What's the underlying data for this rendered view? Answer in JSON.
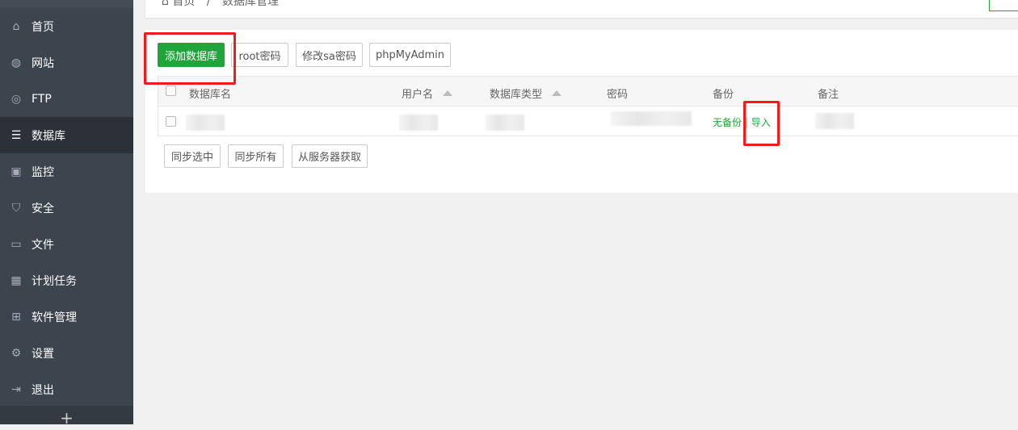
{
  "sidebar": {
    "items": [
      {
        "label": "首页",
        "icon": "home-icon"
      },
      {
        "label": "网站",
        "icon": "globe-icon"
      },
      {
        "label": "FTP",
        "icon": "ftp-icon"
      },
      {
        "label": "数据库",
        "icon": "database-icon"
      },
      {
        "label": "监控",
        "icon": "monitor-icon"
      },
      {
        "label": "安全",
        "icon": "shield-icon"
      },
      {
        "label": "文件",
        "icon": "folder-icon"
      },
      {
        "label": "计划任务",
        "icon": "calendar-icon"
      },
      {
        "label": "软件管理",
        "icon": "apps-icon"
      },
      {
        "label": "设置",
        "icon": "gear-icon"
      },
      {
        "label": "退出",
        "icon": "logout-icon"
      }
    ],
    "active": "数据库",
    "add": "+"
  },
  "breadcrumb": {
    "home": "首页",
    "sep": "/",
    "current": "数据库管理"
  },
  "toolbar": {
    "add_db": "添加数据库",
    "root_pwd": "root密码",
    "sa_pwd": "修改sa密码",
    "phpmyadmin": "phpMyAdmin"
  },
  "table": {
    "headers": [
      "数据库名",
      "用户名",
      "数据库类型",
      "密码",
      "备份",
      "备注"
    ],
    "row": {
      "backup_status": "无备份",
      "sep": "|",
      "import": "导入"
    }
  },
  "bottom": {
    "sync_selected": "同步选中",
    "sync_all": "同步所有",
    "fetch_server": "从服务器获取"
  },
  "colors": {
    "accent": "#20a53a",
    "annotation": "#f21b1b"
  }
}
